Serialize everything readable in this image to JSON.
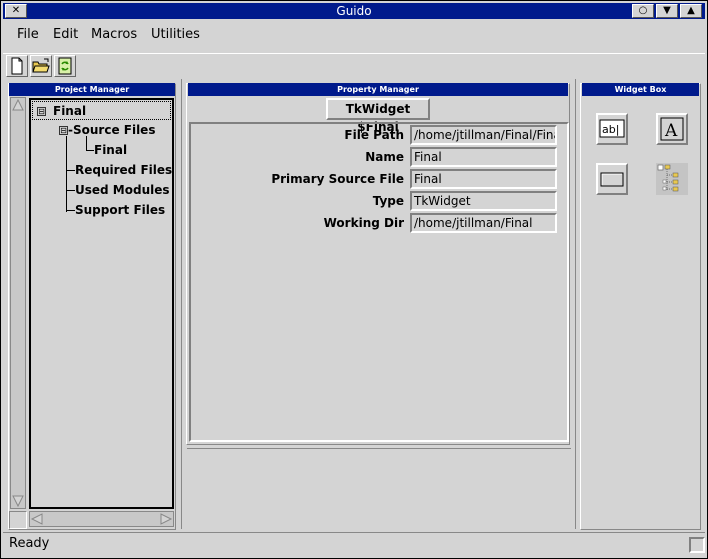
{
  "window": {
    "title": "Guido",
    "close_glyph": "✕",
    "ctrl_minimize_glyph": "○",
    "ctrl_menu_glyph": "▼",
    "ctrl_maximize_glyph": "▲"
  },
  "menubar": {
    "items": [
      {
        "label": "File"
      },
      {
        "label": "Edit"
      },
      {
        "label": "Macros"
      },
      {
        "label": "Utilities"
      }
    ]
  },
  "toolbar": {
    "tools": [
      {
        "icon": "new-file-icon"
      },
      {
        "icon": "open-folder-icon"
      },
      {
        "icon": "refresh-icon"
      }
    ]
  },
  "project_manager": {
    "header": "Project Manager",
    "tree": {
      "root": {
        "label": "Final",
        "expander": "⊟"
      },
      "source_files": {
        "label": "-Source Files",
        "expander": "⊟"
      },
      "source_child": {
        "label": "Final"
      },
      "required_files": {
        "label": "Required Files"
      },
      "used_modules": {
        "label": "Used Modules"
      },
      "support_files": {
        "label": "Support Files"
      }
    }
  },
  "property_manager": {
    "header": "Property Manager",
    "title_button": "TkWidget $Final",
    "rows": [
      {
        "label": "File Path",
        "value": "/home/jtillman/Final/Final"
      },
      {
        "label": "Name",
        "value": "Final"
      },
      {
        "label": "Primary Source File",
        "value": "Final"
      },
      {
        "label": "Type",
        "value": "TkWidget"
      },
      {
        "label": "Working Dir",
        "value": "/home/jtillman/Final"
      }
    ]
  },
  "widget_box": {
    "header": "Widget Box",
    "widgets": [
      {
        "icon": "entry-widget-icon",
        "glyph": "ab|"
      },
      {
        "icon": "label-widget-icon",
        "glyph": "A"
      },
      {
        "icon": "button-widget-icon"
      },
      {
        "icon": "tree-widget-icon"
      }
    ]
  },
  "status_bar": {
    "text": "Ready"
  },
  "colors": {
    "title_bar": "#001a8c",
    "background": "#d4d4d4"
  }
}
